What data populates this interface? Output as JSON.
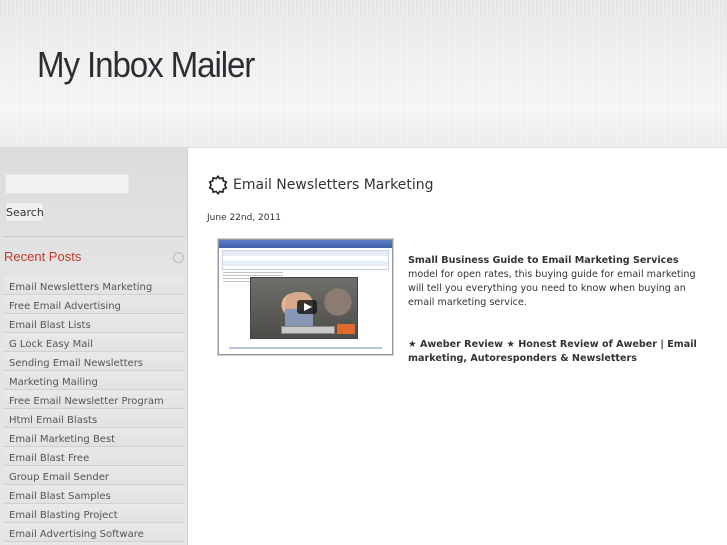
{
  "site": {
    "title": "My Inbox Mailer"
  },
  "sidebar": {
    "search": {
      "value": "",
      "button_label": "Search"
    },
    "recent_posts": {
      "title": "Recent Posts",
      "items": [
        "Email Newsletters Marketing",
        "Free Email Advertising",
        "Email Blast Lists",
        "G Lock Easy Mail",
        "Sending Email Newsletters",
        "Marketing Mailing",
        "Free Email Newsletter Program",
        "Html Email Blasts",
        "Email Marketing Best",
        "Email Blast Free",
        "Group Email Sender",
        "Email Blast Samples",
        "Email Blasting Project",
        "Email Advertising Software"
      ]
    }
  },
  "post": {
    "title": "Email Newsletters Marketing",
    "date": "June 22nd, 2011",
    "excerpt_strong": "Small Business Guide to Email Marketing Services",
    "excerpt_rest": " model for open rates, this buying guide for email marketing will tell you everything you need to know when buying an email marketing service.",
    "link2": "★ Aweber Review ★ Honest Review of Aweber | Email marketing, Autoresponders & Newsletters"
  },
  "colors": {
    "accent": "#c0392b",
    "text": "#333333",
    "sidebar_bg": "#e3e3e3"
  },
  "icons": {
    "post_title_icon": "gear-icon",
    "widget_icon": "circle-icon",
    "video_play": "play-icon"
  }
}
